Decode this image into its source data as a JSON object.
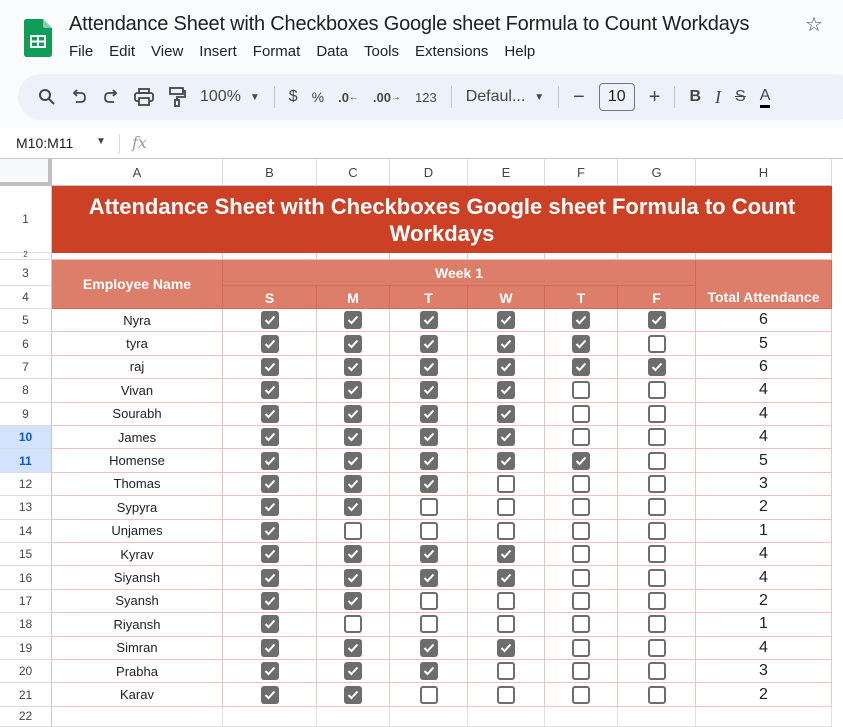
{
  "app": {
    "title": "Attendance Sheet with Checkboxes Google sheet Formula to Count  Workdays",
    "menu": [
      "File",
      "Edit",
      "View",
      "Insert",
      "Format",
      "Data",
      "Tools",
      "Extensions",
      "Help"
    ]
  },
  "toolbar": {
    "zoom": "100%",
    "currency": "$",
    "percent": "%",
    "decrease_decimal": ".0",
    "increase_decimal": ".00",
    "number_format": "123",
    "font": "Defaul...",
    "font_size": "10",
    "minus": "−",
    "plus": "+",
    "bold": "B",
    "italic": "I"
  },
  "formula_bar": {
    "name_box": "M10:M11",
    "fx": "fx",
    "value": ""
  },
  "columns": [
    "A",
    "B",
    "C",
    "D",
    "E",
    "F",
    "G",
    "H"
  ],
  "sheet": {
    "title": "Attendance Sheet with Checkboxes Google sheet Formula to Count Workdays",
    "employee_header": "Employee Name",
    "week_header": "Week 1",
    "days": [
      "S",
      "M",
      "T",
      "W",
      "T",
      "F"
    ],
    "total_header": "Total Attendance",
    "selected_rows": [
      10,
      11
    ],
    "colors": {
      "title_bg": "#cc4125",
      "header_bg": "#dd7e6b",
      "checkbox": "#6d6d6d"
    },
    "rows": [
      {
        "row": 5,
        "name": "Nyra",
        "checks": [
          true,
          true,
          true,
          true,
          true,
          true
        ],
        "total": "6"
      },
      {
        "row": 6,
        "name": "tyra",
        "checks": [
          true,
          true,
          true,
          true,
          true,
          false
        ],
        "total": "5"
      },
      {
        "row": 7,
        "name": "raj",
        "checks": [
          true,
          true,
          true,
          true,
          true,
          true
        ],
        "total": "6"
      },
      {
        "row": 8,
        "name": "Vivan",
        "checks": [
          true,
          true,
          true,
          true,
          false,
          false
        ],
        "total": "4"
      },
      {
        "row": 9,
        "name": "Sourabh",
        "checks": [
          true,
          true,
          true,
          true,
          false,
          false
        ],
        "total": "4"
      },
      {
        "row": 10,
        "name": "James",
        "checks": [
          true,
          true,
          true,
          true,
          false,
          false
        ],
        "total": "4"
      },
      {
        "row": 11,
        "name": "Homense",
        "checks": [
          true,
          true,
          true,
          true,
          true,
          false
        ],
        "total": "5"
      },
      {
        "row": 12,
        "name": "Thomas",
        "checks": [
          true,
          true,
          true,
          false,
          false,
          false
        ],
        "total": "3"
      },
      {
        "row": 13,
        "name": "Sypyra",
        "checks": [
          true,
          true,
          false,
          false,
          false,
          false
        ],
        "total": "2"
      },
      {
        "row": 14,
        "name": "Unjames",
        "checks": [
          true,
          false,
          false,
          false,
          false,
          false
        ],
        "total": "1"
      },
      {
        "row": 15,
        "name": "Kyrav",
        "checks": [
          true,
          true,
          true,
          true,
          false,
          false
        ],
        "total": "4"
      },
      {
        "row": 16,
        "name": "Siyansh",
        "checks": [
          true,
          true,
          true,
          true,
          false,
          false
        ],
        "total": "4"
      },
      {
        "row": 17,
        "name": "Syansh",
        "checks": [
          true,
          true,
          false,
          false,
          false,
          false
        ],
        "total": "2"
      },
      {
        "row": 18,
        "name": "Riyansh",
        "checks": [
          true,
          false,
          false,
          false,
          false,
          false
        ],
        "total": "1"
      },
      {
        "row": 19,
        "name": "Simran",
        "checks": [
          true,
          true,
          true,
          true,
          false,
          false
        ],
        "total": "4"
      },
      {
        "row": 20,
        "name": "Prabha",
        "checks": [
          true,
          true,
          true,
          false,
          false,
          false
        ],
        "total": "3"
      },
      {
        "row": 21,
        "name": "Karav",
        "checks": [
          true,
          true,
          false,
          false,
          false,
          false
        ],
        "total": "2"
      }
    ]
  }
}
